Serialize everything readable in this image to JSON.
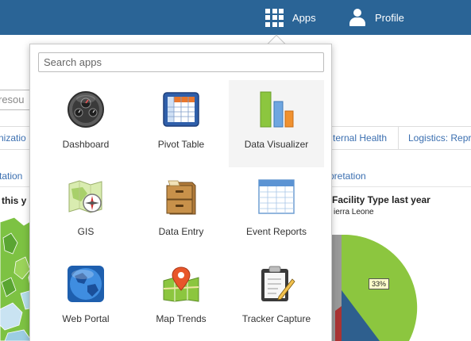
{
  "header": {
    "apps_label": "Apps",
    "profile_label": "Profile",
    "background_color": "#2a6496"
  },
  "dashboard": {
    "search_fragment": "resou",
    "tabs": [
      "nizatio",
      "ternal Health",
      "Logistics: Repr"
    ],
    "sub_links": [
      "tation",
      "rpretation"
    ],
    "chart_left_title": "this y",
    "chart_right_title": "Facility Type last year",
    "chart_right_subtitle": "ierra Leone",
    "pie_label": "33%"
  },
  "apps_menu": {
    "search": {
      "placeholder": "Search apps",
      "value": ""
    },
    "apps": [
      {
        "label": "Dashboard",
        "icon": "dashboard-gauge-icon"
      },
      {
        "label": "Pivot Table",
        "icon": "pivot-table-icon"
      },
      {
        "label": "Data Visualizer",
        "icon": "bar-chart-icon",
        "hovered": true
      },
      {
        "label": "GIS",
        "icon": "map-compass-icon"
      },
      {
        "label": "Data Entry",
        "icon": "filing-cabinet-icon"
      },
      {
        "label": "Event Reports",
        "icon": "spreadsheet-icon"
      },
      {
        "label": "Web Portal",
        "icon": "globe-icon"
      },
      {
        "label": "Map Trends",
        "icon": "map-pin-icon"
      },
      {
        "label": "Tracker Capture",
        "icon": "clipboard-pen-icon"
      }
    ]
  },
  "colors": {
    "link": "#3b6fb0",
    "hover_bg": "#f4f4f4",
    "pie_green": "#8cc63f",
    "pie_blue": "#2e5f8e"
  }
}
